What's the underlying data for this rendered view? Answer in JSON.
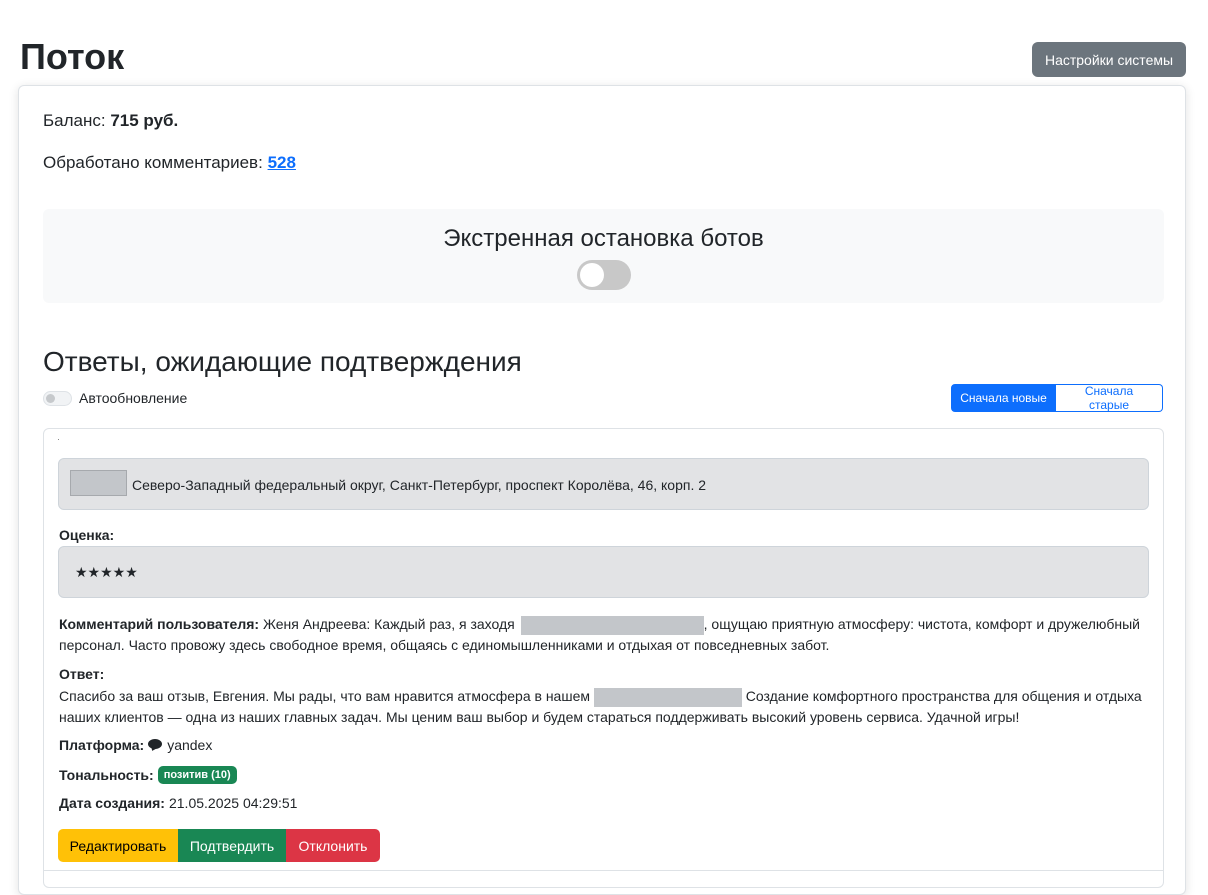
{
  "header": {
    "title": "Поток",
    "settings_label": "Настройки системы"
  },
  "stats": {
    "balance_label": "Баланс:",
    "balance_value": "715 руб.",
    "processed_label": "Обработано комментариев:",
    "processed_value": "528"
  },
  "emergency": {
    "title": "Экстренная остановка ботов",
    "enabled": false
  },
  "pending": {
    "title": "Ответы, ожидающие подтверждения",
    "autorefresh_label": "Автообновление",
    "autorefresh_enabled": false,
    "sort": {
      "newest_label": "Сначала новые",
      "oldest_label": "Сначала старые",
      "selected": "newest"
    }
  },
  "review": {
    "address": "Северо-Западный федеральный округ, Санкт-Петербург, проспект Королёва, 46, корп. 2",
    "rating_label": "Оценка:",
    "rating_stars": "★★★★★",
    "rating_value": 5,
    "comment_label": "Комментарий пользователя:",
    "comment_part1": "Женя Андреева: Каждый раз, я заходя",
    "comment_part2": ", ощущаю приятную атмосферу: чистота, комфорт и дружелюбный персонал. Часто провожу здесь свободное время, общаясь с единомышленниками и отдыхая от повседневных забот.",
    "answer_label": "Ответ:",
    "answer_part1": "Спасибо за ваш отзыв, Евгения. Мы рады, что вам нравится атмосфера в нашем",
    "answer_part2": "Создание комфортного пространства для общения и отдыха наших клиентов — одна из наших главных задач. Мы ценим ваш выбор и будем стараться поддерживать высокий уровень сервиса. Удачной игры!",
    "platform_label": "Платформа:",
    "platform_icon": "chat-bubble-icon",
    "platform_value": "yandex",
    "tone_label": "Тональность:",
    "tone_value": "позитив (10)",
    "created_label": "Дата создания:",
    "created_value": "21.05.2025 04:29:51",
    "edit_label": "Редактировать",
    "confirm_label": "Подтвердить",
    "reject_label": "Отклонить"
  },
  "colors": {
    "primary": "#0d6efd",
    "secondary": "#6c757d",
    "success": "#198754",
    "warning": "#ffc107",
    "danger": "#dc3545"
  }
}
